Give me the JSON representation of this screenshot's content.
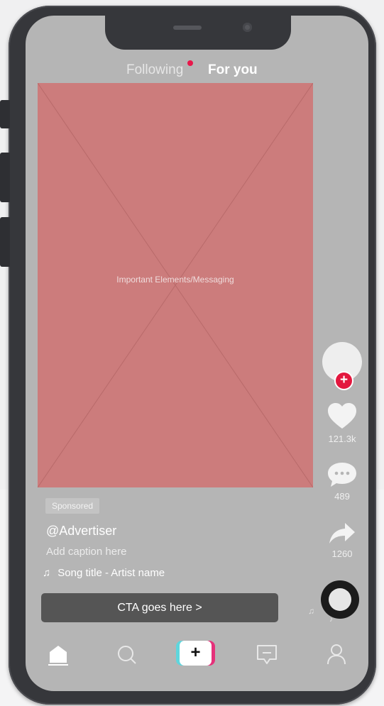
{
  "header": {
    "tabs": [
      {
        "label": "Following",
        "has_notification_dot": true
      },
      {
        "label": "For you",
        "active": true
      }
    ]
  },
  "video": {
    "placeholder_label": "Important Elements/Messaging"
  },
  "actions": {
    "likes": "121.3k",
    "comments": "489",
    "shares": "1260"
  },
  "post": {
    "badge": "Sponsored",
    "handle": "@Advertiser",
    "caption": "Add caption here",
    "song": "Song title - Artist name"
  },
  "cta": {
    "label": "CTA goes here >"
  },
  "create_button": {
    "label": "+"
  },
  "colors": {
    "phone_frame": "#36373b",
    "screen_bg": "#b5b5b5",
    "video_placeholder": "#cc7c7c",
    "accent_red": "#e3173e",
    "cta_bg": "#555555",
    "create_left": "#5fd6dd",
    "create_right": "#e5317a"
  },
  "icons": [
    "heart-icon",
    "comment-icon",
    "share-icon",
    "music-note-icon",
    "home-icon",
    "search-icon",
    "inbox-icon",
    "profile-icon",
    "plus-icon"
  ]
}
